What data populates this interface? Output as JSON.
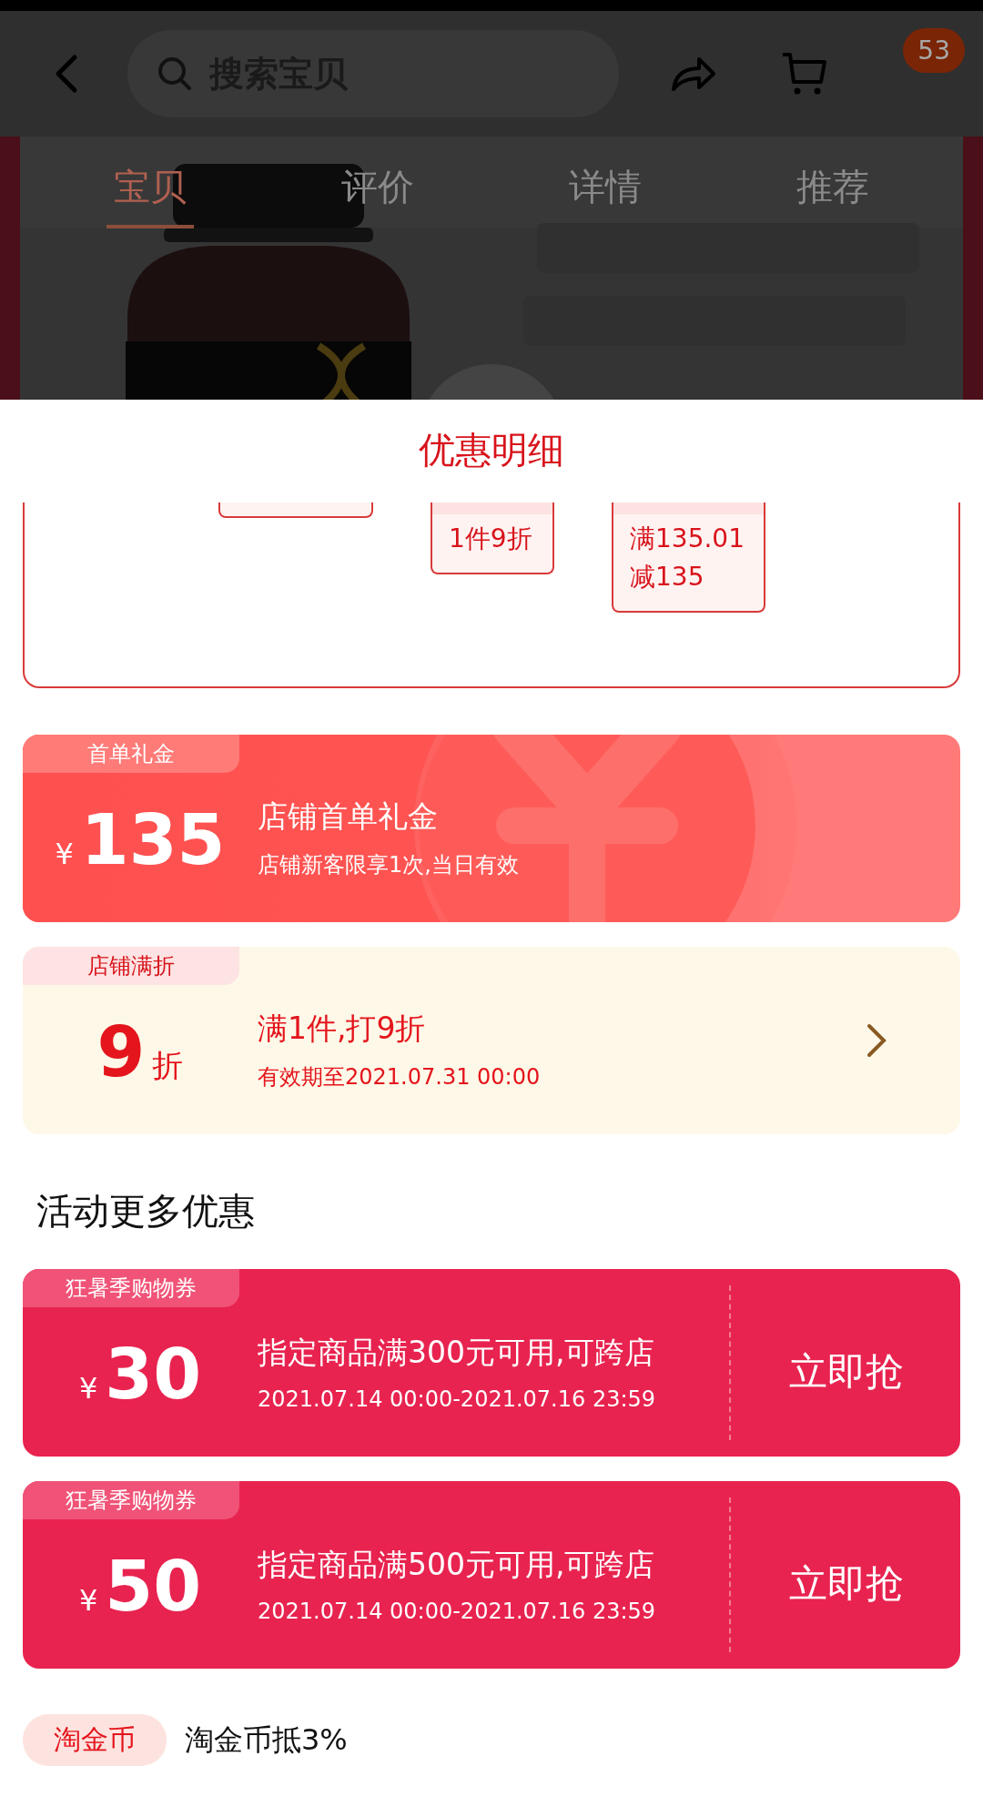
{
  "header": {
    "search": {
      "placeholder": "搜索宝贝"
    },
    "badge": "53"
  },
  "product_tabs": [
    {
      "label": "宝贝",
      "selected": true
    },
    {
      "label": "评价",
      "selected": false
    },
    {
      "label": "详情",
      "selected": false
    },
    {
      "label": "推荐",
      "selected": false
    }
  ],
  "sheet": {
    "title": "优惠明细",
    "promo_tags": [
      {
        "kind": "tag"
      },
      {
        "kind": "tag",
        "lines": [
          "1件9折"
        ]
      },
      {
        "kind": "tag",
        "lines": [
          "满135.01",
          "减135"
        ]
      }
    ]
  },
  "coupons": [
    {
      "kind": "gift",
      "tag": "首单礼金",
      "currency": "¥",
      "amount": "135",
      "title": "店铺首单礼金",
      "subtitle": "店铺新客限享1次,当日有效"
    },
    {
      "kind": "discount",
      "tag": "店铺满折",
      "amount": "9",
      "unit": "折",
      "title": "满1件,打9折",
      "subtitle": "有效期至2021.07.31 00:00"
    }
  ],
  "more_heading": "活动更多优惠",
  "vouchers": [
    {
      "tag": "狂暑季购物券",
      "currency": "¥",
      "amount": "30",
      "title": "指定商品满300元可用,可跨店",
      "period": "2021.07.14 00:00-2021.07.16 23:59",
      "action": "立即抢"
    },
    {
      "tag": "狂暑季购物券",
      "currency": "¥",
      "amount": "50",
      "title": "指定商品满500元可用,可跨店",
      "period": "2021.07.14 00:00-2021.07.16 23:59",
      "action": "立即抢"
    }
  ],
  "coin": {
    "badge": "淘金币",
    "text": "淘金币抵3%"
  }
}
